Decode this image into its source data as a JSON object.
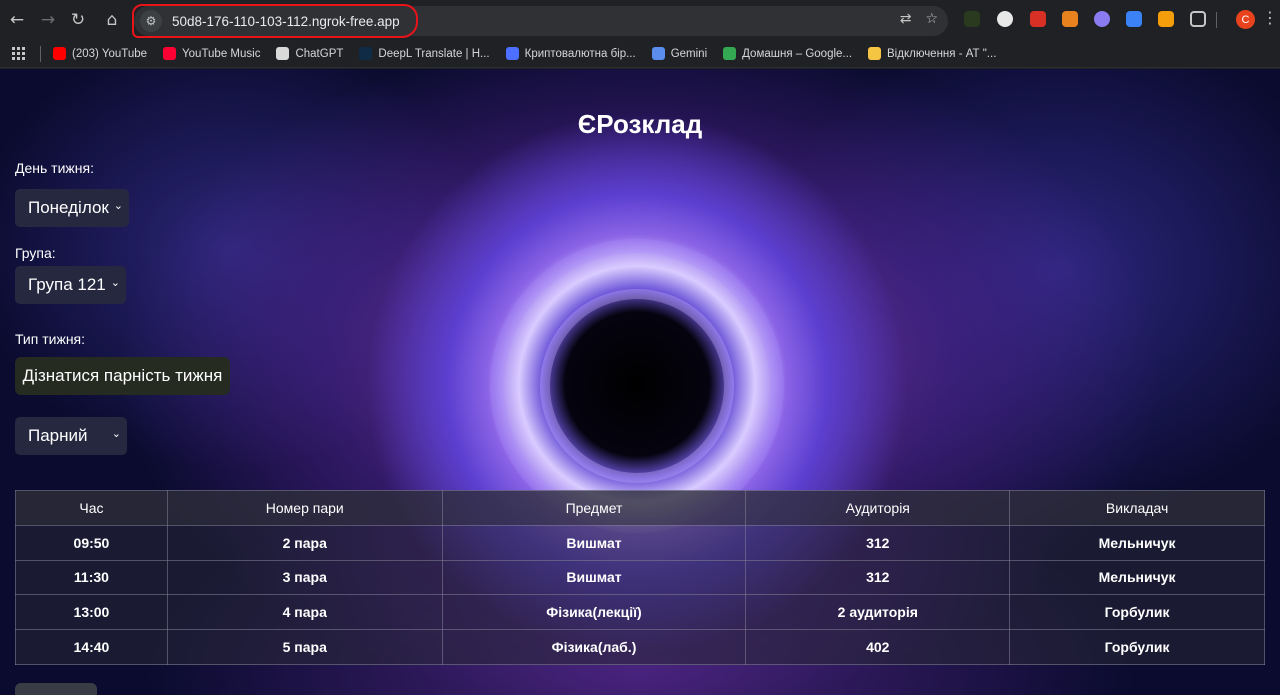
{
  "browser": {
    "url": "50d8-176-110-103-112.ngrok-free.app",
    "profile_initial": "C",
    "bookmarks": [
      {
        "label": "(203) YouTube",
        "color": "#ff0000"
      },
      {
        "label": "YouTube Music",
        "color": "#ff0033"
      },
      {
        "label": "ChatGPT",
        "color": "#d9d9d9"
      },
      {
        "label": "DeepL Translate | Н...",
        "color": "#0f2b46"
      },
      {
        "label": "Криптовалютна бір...",
        "color": "#4c6fff"
      },
      {
        "label": "Gemini",
        "color": "#5b8def"
      },
      {
        "label": "Домашня – Google...",
        "color": "#34a853"
      },
      {
        "label": "Відключення - АТ \"...",
        "color": "#f4c542"
      }
    ]
  },
  "page": {
    "title": "ЄРозклад",
    "day_label": "День тижня:",
    "day_value": "Понеділок",
    "group_label": "Група:",
    "group_value": "Група 121",
    "week_type_label": "Тип тижня:",
    "check_parity_button": "Дізнатися парність тижня",
    "week_type_value": "Парний"
  },
  "table": {
    "headers": [
      "Час",
      "Номер пари",
      "Предмет",
      "Аудиторія",
      "Викладач"
    ],
    "rows": [
      [
        "09:50",
        "2 пара",
        "Вишмат",
        "312",
        "Мельничук"
      ],
      [
        "11:30",
        "3 пара",
        "Вишмат",
        "312",
        "Мельничук"
      ],
      [
        "13:00",
        "4 пара",
        "Фізика(лекції)",
        "2 аудиторія",
        "Горбулик"
      ],
      [
        "14:40",
        "5 пара",
        "Фізика(лаб.)",
        "402",
        "Горбулик"
      ]
    ]
  }
}
